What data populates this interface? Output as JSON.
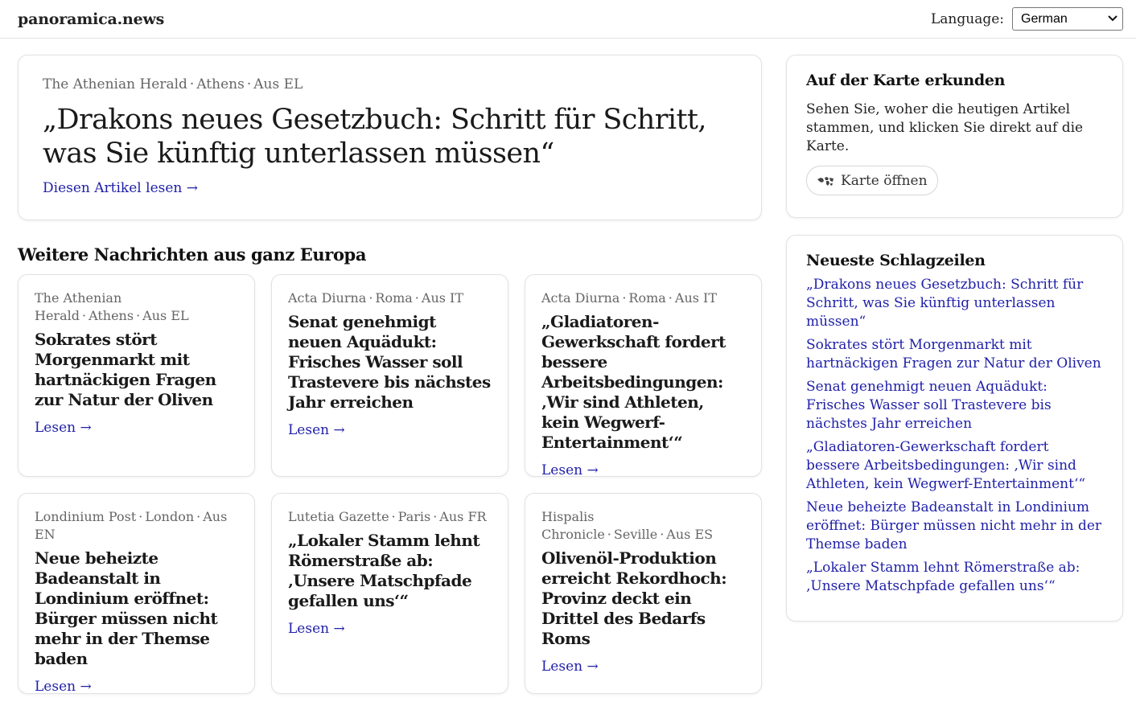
{
  "header": {
    "brand": "panoramica.news",
    "language_label": "Language:",
    "language_selected": "German"
  },
  "hero": {
    "source": "The Athenian Herald",
    "city": "Athens",
    "origin": "Aus EL",
    "title": "„Drakons neues Gesetzbuch: Schritt für Schritt, was Sie künftig unterlassen müssen“",
    "link": "Diesen Artikel lesen →"
  },
  "section_title": "Weitere Nachrichten aus ganz Europa",
  "articles": [
    {
      "source": "The Athenian Herald",
      "city": "Athens",
      "origin": "Aus EL",
      "title": "Sokrates stört Morgenmarkt mit hartnäckigen Fragen zur Natur der Oliven",
      "link": "Lesen →"
    },
    {
      "source": "Acta Diurna",
      "city": "Roma",
      "origin": "Aus IT",
      "title": "Senat genehmigt neuen Aquädukt: Frisches Wasser soll Trastevere bis nächstes Jahr erreichen",
      "link": "Lesen →"
    },
    {
      "source": "Acta Diurna",
      "city": "Roma",
      "origin": "Aus IT",
      "title": "„Gladiatoren-Gewerkschaft fordert bessere Arbeitsbedingungen: ‚Wir sind Athleten, kein Wegwerf-Entertainment‘“",
      "link": "Lesen →"
    },
    {
      "source": "Londinium Post",
      "city": "London",
      "origin": "Aus EN",
      "title": "Neue beheizte Badeanstalt in Londinium eröffnet: Bürger müssen nicht mehr in der Themse baden",
      "link": "Lesen →"
    },
    {
      "source": "Lutetia Gazette",
      "city": "Paris",
      "origin": "Aus FR",
      "title": "„Lokaler Stamm lehnt Römerstraße ab: ‚Unsere Matschpfade gefallen uns‘“",
      "link": "Lesen →"
    },
    {
      "source": "Hispalis Chronicle",
      "city": "Seville",
      "origin": "Aus ES",
      "title": "Olivenöl-Produktion erreicht Rekordhoch: Provinz deckt ein Drittel des Bedarfs Roms",
      "link": "Lesen →"
    }
  ],
  "sidebar": {
    "map": {
      "title": "Auf der Karte erkunden",
      "text": "Sehen Sie, woher die heutigen Artikel stammen, und klicken Sie direkt auf die Karte.",
      "button": "Karte öffnen"
    },
    "headlines": {
      "title": "Neueste Schlagzeilen",
      "items": [
        "„Drakons neues Gesetzbuch: Schritt für Schritt, was Sie künftig unterlassen müssen“",
        "Sokrates stört Morgenmarkt mit hartnäckigen Fragen zur Natur der Oliven",
        "Senat genehmigt neuen Aquädukt: Frisches Wasser soll Trastevere bis nächstes Jahr erreichen",
        "„Gladiatoren-Gewerkschaft fordert bessere Arbeitsbedingungen: ‚Wir sind Athleten, kein Wegwerf-Entertainment‘“",
        "Neue beheizte Badeanstalt in Londinium eröffnet: Bürger müssen nicht mehr in der Themse baden",
        "„Lokaler Stamm lehnt Römerstraße ab: ‚Unsere Matschpfade gefallen uns‘“"
      ]
    }
  },
  "colors": {
    "link": "#1f1fa8",
    "meta": "#666666",
    "border": "#e2e2e2"
  }
}
